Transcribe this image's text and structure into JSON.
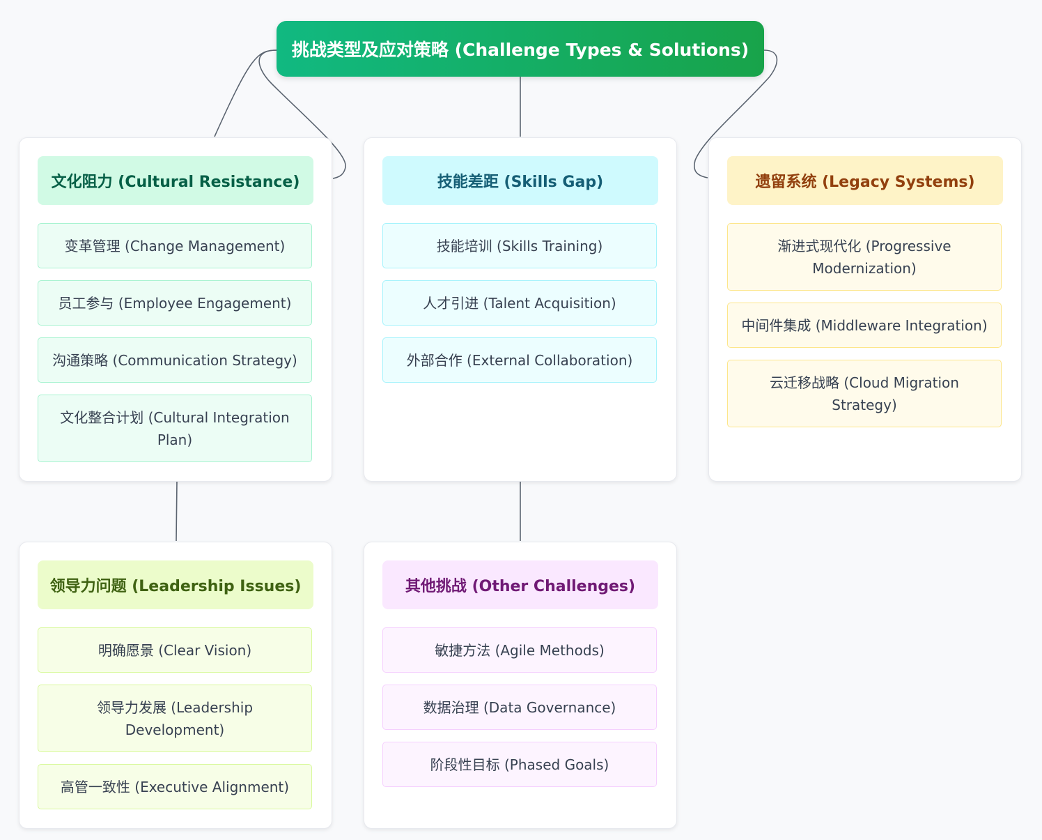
{
  "root": {
    "label": "挑战类型及应对策略 (Challenge Types & Solutions)"
  },
  "colors": {
    "root_gradient_start": "#11b981",
    "root_gradient_end": "#18a34a",
    "connector": "#5b6470"
  },
  "categories": [
    {
      "title": "文化阻力 (Cultural Resistance)",
      "theme": "green",
      "items": [
        "变革管理 (Change Management)",
        "员工参与 (Employee Engagement)",
        "沟通策略 (Communication Strategy)",
        "文化整合计划 (Cultural Integration Plan)"
      ]
    },
    {
      "title": "技能差距 (Skills Gap)",
      "theme": "cyan",
      "items": [
        "技能培训 (Skills Training)",
        "人才引进 (Talent Acquisition)",
        "外部合作 (External Collaboration)"
      ]
    },
    {
      "title": "遗留系统 (Legacy Systems)",
      "theme": "amber",
      "items": [
        "渐进式现代化 (Progressive Modernization)",
        "中间件集成 (Middleware Integration)",
        "云迁移战略 (Cloud Migration Strategy)"
      ]
    },
    {
      "title": "领导力问题 (Leadership Issues)",
      "theme": "lime",
      "items": [
        "明确愿景 (Clear Vision)",
        "领导力发展 (Leadership Development)",
        "高管一致性 (Executive Alignment)"
      ]
    },
    {
      "title": "其他挑战 (Other Challenges)",
      "theme": "pink",
      "items": [
        "敏捷方法 (Agile Methods)",
        "数据治理 (Data Governance)",
        "阶段性目标 (Phased Goals)"
      ]
    }
  ]
}
